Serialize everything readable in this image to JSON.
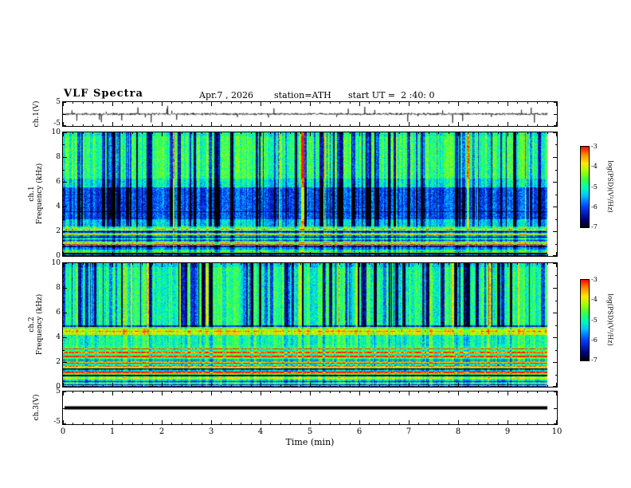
{
  "header": {
    "title": "VLF Spectra",
    "date": "Apr.7 , 2026",
    "station": "station=ATH",
    "start_ut": "start UT =  2 :40: 0"
  },
  "time_axis": {
    "label": "Time (min)",
    "min": 0,
    "max": 10,
    "major_step": 1,
    "minor_step": 0.2,
    "data_end": 9.8,
    "tick_labels": [
      "0",
      "1",
      "2",
      "3",
      "4",
      "5",
      "6",
      "7",
      "8",
      "9",
      "10"
    ]
  },
  "colorbar": {
    "label": "log(PSD)(V²/Hz)",
    "ticks": [
      "-3",
      "-4",
      "-5",
      "-6",
      "-7"
    ],
    "min": -7,
    "max": -3,
    "stops": [
      [
        0,
        "#000000"
      ],
      [
        0.1,
        "#000080"
      ],
      [
        0.26,
        "#0040ff"
      ],
      [
        0.4,
        "#00c8ff"
      ],
      [
        0.5,
        "#00ffb0"
      ],
      [
        0.6,
        "#40ff40"
      ],
      [
        0.7,
        "#a8ff00"
      ],
      [
        0.8,
        "#ffe800"
      ],
      [
        0.9,
        "#ff9000"
      ],
      [
        1,
        "#ff1000"
      ]
    ]
  },
  "chart_data": [
    {
      "id": "ch1-wave",
      "type": "line",
      "ylabel": "ch.1(V)",
      "ylim": [
        -5,
        5
      ],
      "ytick_labels": [
        "5",
        "-5"
      ],
      "x_range": [
        0,
        9.8
      ],
      "description": "broadband noise waveform, ~±0.6 V with impulsive spikes to ±3.5 V",
      "noise": {
        "seed": 11,
        "points": 1500,
        "amp": 0.55,
        "spike_prob": 0.018,
        "spike_amp": 3.6
      }
    },
    {
      "id": "ch1-spec",
      "type": "heatmap",
      "ylabel_lines": [
        "ch.1",
        "Frequency (kHz)"
      ],
      "ylim": [
        0,
        10
      ],
      "ytick_labels": [
        "10",
        "8",
        "6",
        "4",
        "2",
        "0"
      ],
      "value_range": [
        -7,
        -3
      ],
      "description": "spectrogram: green background ~-4.7, blue suppressed band 3-5.6 kHz, dense blue vertical striations, dark/red horizontal lines below 2.3 kHz",
      "render": {
        "seed": 21,
        "base": 0.56,
        "texture": {
          "pixel": 0.11,
          "column": 0.1
        },
        "vstripes": {
          "prob": 0.3,
          "dark_min": 0.18,
          "dark_max": 0.5,
          "bright_prob": 0.06,
          "bright_amp": 0.3,
          "fmin": 2.4,
          "below_factor": 0.35
        },
        "bands": [
          {
            "f0": 3.0,
            "f1": 5.6,
            "bias": -0.3
          },
          {
            "f0": 2.4,
            "f1": 3.0,
            "bias": -0.15
          },
          {
            "f0": 5.6,
            "f1": 6.3,
            "bias": -0.1
          },
          {
            "f0": 9.7,
            "f1": 10,
            "bias": -0.06
          }
        ],
        "hlines": [
          {
            "f": 3.6,
            "bias": -0.15,
            "hw": 0.04
          },
          {
            "f": 2.15,
            "bias": 0.4,
            "hw": 0.05
          },
          {
            "f": 1.95,
            "bias": -0.45,
            "hw": 0.06
          },
          {
            "f": 1.75,
            "bias": 0.18,
            "hw": 0.04
          },
          {
            "f": 1.55,
            "bias": -0.4,
            "hw": 0.05
          },
          {
            "f": 1.3,
            "bias": -0.35,
            "hw": 0.05
          },
          {
            "f": 1.1,
            "bias": 0.15,
            "hw": 0.04
          },
          {
            "f": 0.95,
            "bias": 0.32,
            "hw": 0.03
          },
          {
            "f": 0.8,
            "bias": -0.45,
            "hw": 0.05
          },
          {
            "f": 0.6,
            "bias": -0.3,
            "hw": 0.04
          },
          {
            "f": 0.45,
            "bias": 0.12,
            "hw": 0.03
          },
          {
            "f": 0.25,
            "bias": -0.5,
            "hw": 0.06
          },
          {
            "f": 0.05,
            "bias": -0.55,
            "hw": 0.05
          }
        ],
        "hstripes": {
          "f0": 0,
          "f1": 2.3,
          "amp": 0.22
        }
      }
    },
    {
      "id": "ch2-spec",
      "type": "heatmap",
      "ylabel_lines": [
        "ch.2",
        "Frequency (kHz)"
      ],
      "ylim": [
        0,
        10
      ],
      "ytick_labels": [
        "10",
        "8",
        "6",
        "4",
        "2",
        "0"
      ],
      "value_range": [
        -7,
        -3
      ],
      "description": "spectrogram: green background, blue vertical striations above ~5 kHz, hot yellow band 4.25-4.75 kHz, red horizontal lines 1.2-3.1 kHz, dark lines near 0",
      "render": {
        "seed": 22,
        "base": 0.57,
        "texture": {
          "pixel": 0.11,
          "column": 0.1
        },
        "vstripes": {
          "prob": 0.32,
          "dark_min": 0.22,
          "dark_max": 0.55,
          "bright_prob": 0.05,
          "bright_amp": 0.26,
          "fmin": 4.9,
          "below_factor": 0.25
        },
        "bands": [
          {
            "f0": 4.25,
            "f1": 4.75,
            "bias": 0.2
          },
          {
            "f0": 3.4,
            "f1": 4.25,
            "bias": -0.04
          },
          {
            "f0": 5.0,
            "f1": 10,
            "bias": -0.04
          },
          {
            "f0": 9.7,
            "f1": 10,
            "bias": -0.08
          }
        ],
        "hlines": [
          {
            "f": 4.95,
            "bias": -0.35,
            "hw": 0.05
          },
          {
            "f": 4.5,
            "bias": 0.15,
            "hw": 0.04
          },
          {
            "f": 3.1,
            "bias": 0.42,
            "hw": 0.04
          },
          {
            "f": 2.8,
            "bias": 0.4,
            "hw": 0.04
          },
          {
            "f": 2.5,
            "bias": 0.45,
            "hw": 0.05
          },
          {
            "f": 2.2,
            "bias": -0.3,
            "hw": 0.04
          },
          {
            "f": 1.95,
            "bias": 0.4,
            "hw": 0.05
          },
          {
            "f": 1.7,
            "bias": 0.35,
            "hw": 0.04
          },
          {
            "f": 1.45,
            "bias": -0.4,
            "hw": 0.05
          },
          {
            "f": 1.2,
            "bias": 0.3,
            "hw": 0.04
          },
          {
            "f": 0.95,
            "bias": -0.45,
            "hw": 0.05
          },
          {
            "f": 0.7,
            "bias": 0.25,
            "hw": 0.04
          },
          {
            "f": 0.45,
            "bias": -0.5,
            "hw": 0.06
          },
          {
            "f": 0.2,
            "bias": -0.4,
            "hw": 0.05
          },
          {
            "f": 0.05,
            "bias": -0.5,
            "hw": 0.04
          }
        ],
        "hstripes": {
          "f0": 0,
          "f1": 2.1,
          "amp": 0.2
        }
      }
    },
    {
      "id": "ch3-wave",
      "type": "flatline",
      "ylabel": "ch.3(V)",
      "ylim": [
        -5,
        5
      ],
      "ytick_labels": [
        "5",
        "-5"
      ],
      "x_range": [
        0,
        9.8
      ],
      "value": 0,
      "thickness": 4,
      "description": "flat (zero) signal drawn as a thick black line"
    }
  ]
}
